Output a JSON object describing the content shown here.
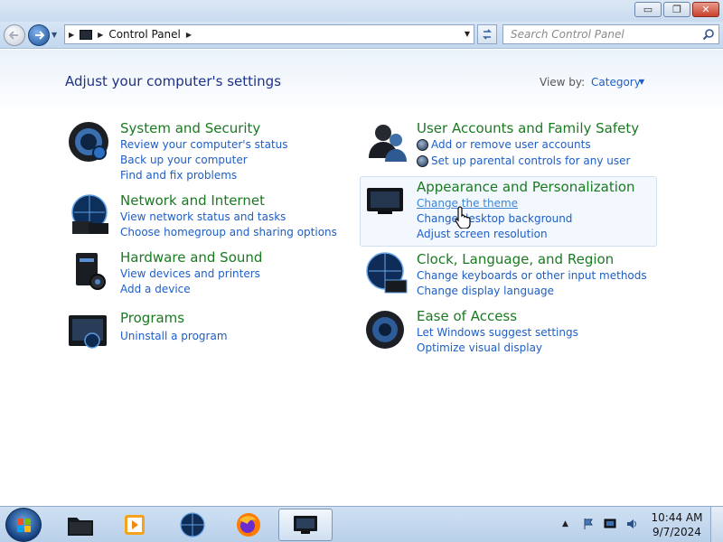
{
  "window": {
    "minimize": "▭",
    "maximize": "❐",
    "close": "✕"
  },
  "address_bar": {
    "path": "Control Panel",
    "search_placeholder": "Search Control Panel"
  },
  "content": {
    "title": "Adjust your computer's settings",
    "view_by_label": "View by:",
    "view_by_value": "Category"
  },
  "categories": {
    "system": {
      "title": "System and Security",
      "links": [
        "Review your computer's status",
        "Back up your computer",
        "Find and fix problems"
      ]
    },
    "network": {
      "title": "Network and Internet",
      "links": [
        "View network status and tasks",
        "Choose homegroup and sharing options"
      ]
    },
    "hardware": {
      "title": "Hardware and Sound",
      "links": [
        "View devices and printers",
        "Add a device"
      ]
    },
    "programs": {
      "title": "Programs",
      "links": [
        "Uninstall a program"
      ]
    },
    "users": {
      "title": "User Accounts and Family Safety",
      "links": [
        "Add or remove user accounts",
        "Set up parental controls for any user"
      ]
    },
    "appearance": {
      "title": "Appearance and Personalization",
      "links": [
        "Change the theme",
        "Change desktop background",
        "Adjust screen resolution"
      ]
    },
    "clock": {
      "title": "Clock, Language, and Region",
      "links": [
        "Change keyboards or other input methods",
        "Change display language"
      ]
    },
    "ease": {
      "title": "Ease of Access",
      "links": [
        "Let Windows suggest settings",
        "Optimize visual display"
      ]
    }
  },
  "taskbar": {
    "time": "10:44 AM",
    "date": "9/7/2024"
  },
  "colors": {
    "category_title": "#1a7a21",
    "link": "#1e5ec6",
    "page_title": "#1e3287"
  }
}
